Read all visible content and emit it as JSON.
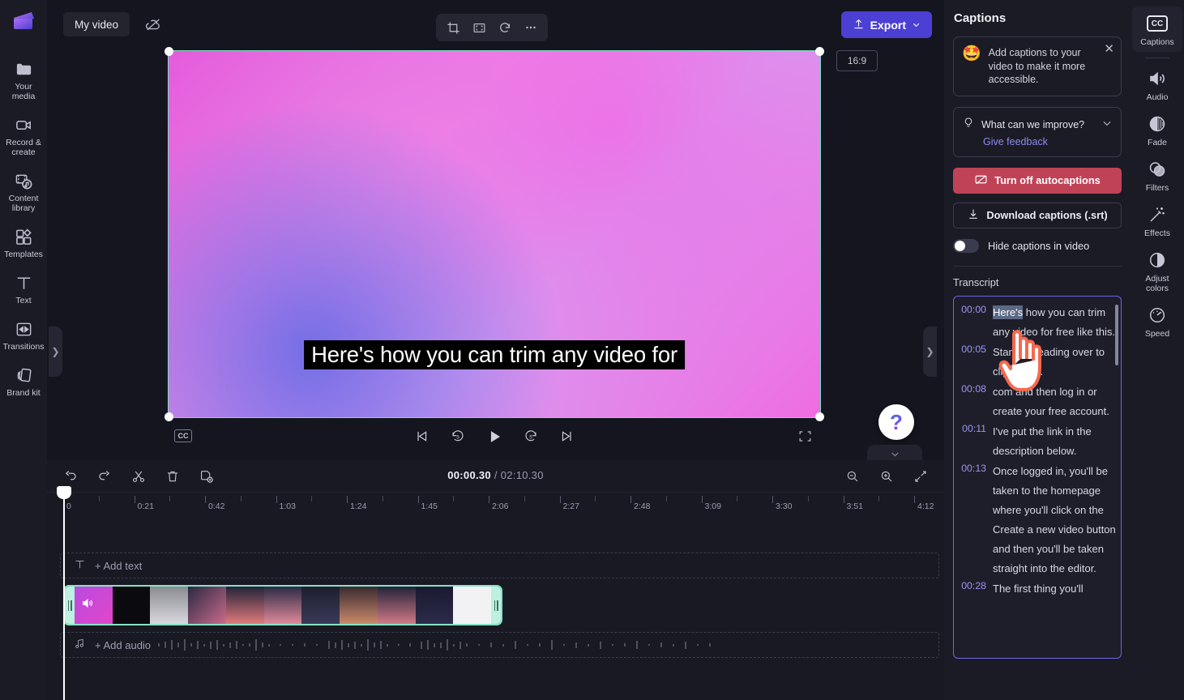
{
  "app": {
    "project_name": "My video",
    "export_label": "Export",
    "aspect_ratio": "16:9"
  },
  "left_rail": {
    "items": [
      {
        "label": "Your media",
        "icon": "folder-icon"
      },
      {
        "label": "Record & create",
        "icon": "video-camera-icon"
      },
      {
        "label": "Content library",
        "icon": "content-library-icon"
      },
      {
        "label": "Templates",
        "icon": "templates-icon"
      },
      {
        "label": "Text",
        "icon": "text-icon"
      },
      {
        "label": "Transitions",
        "icon": "transitions-icon"
      },
      {
        "label": "Brand kit",
        "icon": "brand-kit-icon"
      }
    ]
  },
  "preview": {
    "caption_text": "Here's how you can trim any video for",
    "cc_label": "CC"
  },
  "timeline": {
    "current_time": "00:00.30",
    "separator": "/",
    "total_time": "02:10.30",
    "add_text_label": "+ Add text",
    "add_audio_label": "+ Add audio",
    "ruler_ticks": [
      "0",
      "0:21",
      "0:42",
      "1:03",
      "1:24",
      "1:45",
      "2:06",
      "2:27",
      "2:48",
      "3:09",
      "3:30",
      "3:51",
      "4:12"
    ]
  },
  "captions_panel": {
    "title": "Captions",
    "promo": {
      "emoji": "🤩",
      "text": "Add captions to your video to make it more accessible."
    },
    "feedback": {
      "question": "What can we improve?",
      "link": "Give feedback"
    },
    "turn_off_label": "Turn off autocaptions",
    "download_label": "Download captions (.srt)",
    "hide_captions_label": "Hide captions in video",
    "transcript_title": "Transcript",
    "transcript": [
      {
        "time": "00:00",
        "highlight": "Here's",
        "text": " how you can trim any video for free like this."
      },
      {
        "time": "00:05",
        "highlight": "",
        "text": "Start by heading over to clipchamp."
      },
      {
        "time": "00:08",
        "highlight": "",
        "text": "com and then log in or create your free account."
      },
      {
        "time": "00:11",
        "highlight": "",
        "text": "I've put the link in the description below."
      },
      {
        "time": "00:13",
        "highlight": "",
        "text": "Once logged in, you'll be taken to the homepage where you'll click on the Create a new video button and then you'll be taken straight into the editor."
      },
      {
        "time": "00:28",
        "highlight": "",
        "text": "The first thing you'll"
      }
    ]
  },
  "right_rail": {
    "items": [
      {
        "label": "Captions",
        "icon": "closed-captions-icon",
        "active": true
      },
      {
        "label": "Audio",
        "icon": "speaker-icon",
        "active": false
      },
      {
        "label": "Fade",
        "icon": "fade-icon",
        "active": false
      },
      {
        "label": "Filters",
        "icon": "filters-icon",
        "active": false
      },
      {
        "label": "Effects",
        "icon": "magic-wand-icon",
        "active": false
      },
      {
        "label": "Adjust colors",
        "icon": "contrast-icon",
        "active": false
      },
      {
        "label": "Speed",
        "icon": "speedometer-icon",
        "active": false
      }
    ]
  },
  "colors": {
    "accent": "#4b3fd4",
    "danger": "#c04257",
    "link": "#8d8af0",
    "clip_border": "#86e3c4"
  }
}
